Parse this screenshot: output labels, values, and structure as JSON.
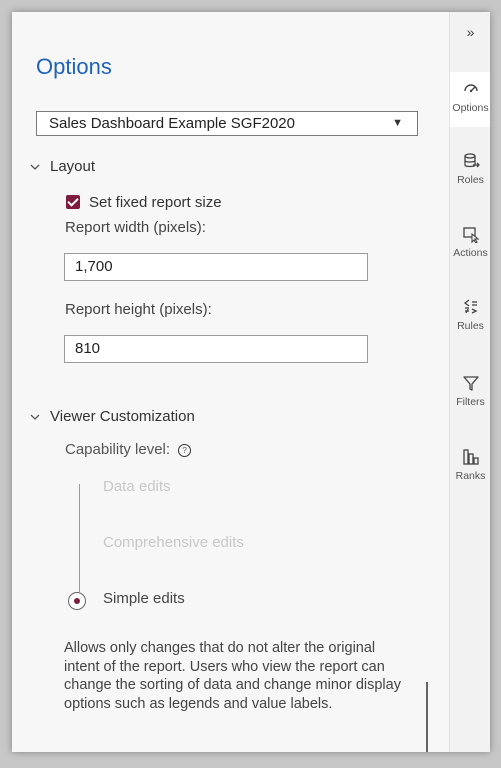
{
  "panel": {
    "title": "Options",
    "report_select": {
      "value": "Sales Dashboard Example SGF2020",
      "caret": "▼"
    }
  },
  "layout_section": {
    "header": "Layout",
    "fixed_size_label": "Set fixed report size",
    "fixed_size_checked": true,
    "width_label": "Report width (pixels):",
    "width_value": "1,700",
    "height_label": "Report height (pixels):",
    "height_value": "810"
  },
  "viewer_section": {
    "header": "Viewer Customization",
    "capability_label": "Capability level:",
    "levels": [
      {
        "label": "Data edits",
        "enabled": false
      },
      {
        "label": "Comprehensive edits",
        "enabled": false
      },
      {
        "label": "Simple edits",
        "enabled": true,
        "selected": true
      }
    ],
    "description": "Allows only changes that do not alter the original intent of the report. Users who view the report can change the sorting of data and change minor display options such as legends and value labels."
  },
  "rail": {
    "expand": "»",
    "items": [
      {
        "label": "Options",
        "icon": "options-icon",
        "active": true
      },
      {
        "label": "Roles",
        "icon": "roles-icon"
      },
      {
        "label": "Actions",
        "icon": "actions-icon"
      },
      {
        "label": "Rules",
        "icon": "rules-icon"
      },
      {
        "label": "Filters",
        "icon": "filter-icon"
      },
      {
        "label": "Ranks",
        "icon": "ranks-icon"
      }
    ]
  },
  "colors": {
    "title": "#1f63b8",
    "accent": "#7e1b3e"
  }
}
